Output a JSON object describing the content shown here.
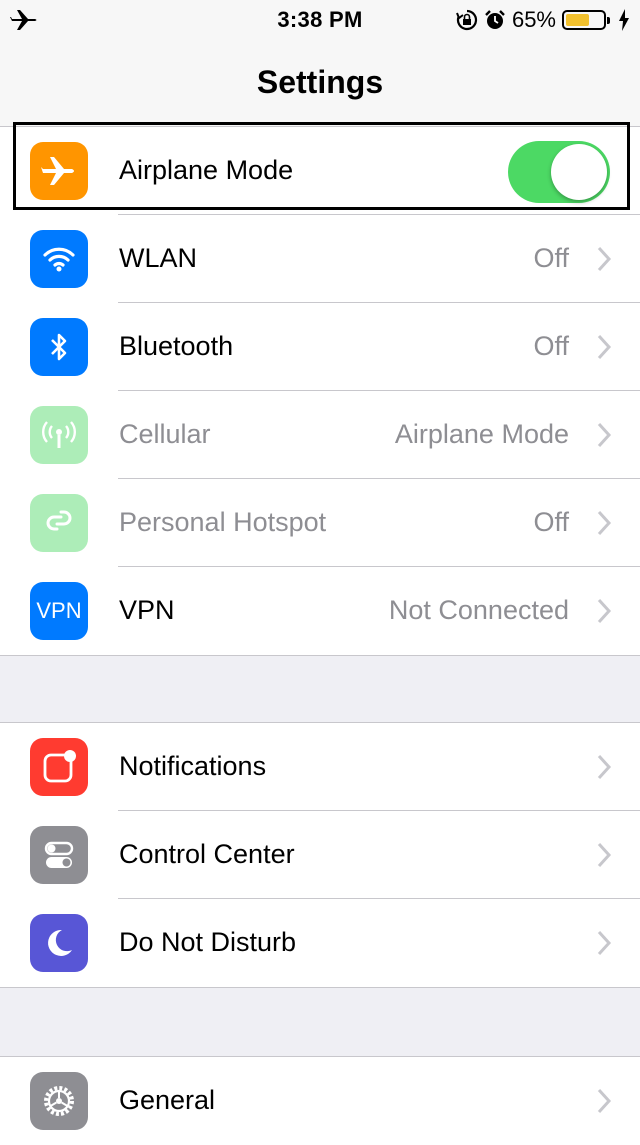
{
  "status_bar": {
    "time": "3:38 PM",
    "battery_percent": "65%",
    "battery_level": 0.65,
    "icons": [
      "airplane-icon",
      "orientation-lock-icon",
      "alarm-icon",
      "battery-icon",
      "charging-bolt-icon"
    ]
  },
  "nav": {
    "title": "Settings"
  },
  "colors": {
    "toggle_on": "#4cd964",
    "airplane": "#ff9500",
    "wlan": "#007aff",
    "bluetooth": "#007aff",
    "cellular": "#4cd964",
    "hotspot": "#4cd964",
    "vpn": "#007aff",
    "notifications": "#ff3b30",
    "control_center": "#8e8e93",
    "dnd": "#5856d6",
    "general": "#8e8e93"
  },
  "group1": {
    "airplane": {
      "label": "Airplane Mode",
      "toggle_on": true
    },
    "wlan": {
      "label": "WLAN",
      "value": "Off"
    },
    "bluetooth": {
      "label": "Bluetooth",
      "value": "Off"
    },
    "cellular": {
      "label": "Cellular",
      "value": "Airplane Mode"
    },
    "hotspot": {
      "label": "Personal Hotspot",
      "value": "Off"
    },
    "vpn": {
      "label": "VPN",
      "value": "Not Connected",
      "icon_text": "VPN"
    }
  },
  "group2": {
    "notifications": {
      "label": "Notifications"
    },
    "control_center": {
      "label": "Control Center"
    },
    "dnd": {
      "label": "Do Not Disturb"
    }
  },
  "group3": {
    "general": {
      "label": "General"
    }
  }
}
